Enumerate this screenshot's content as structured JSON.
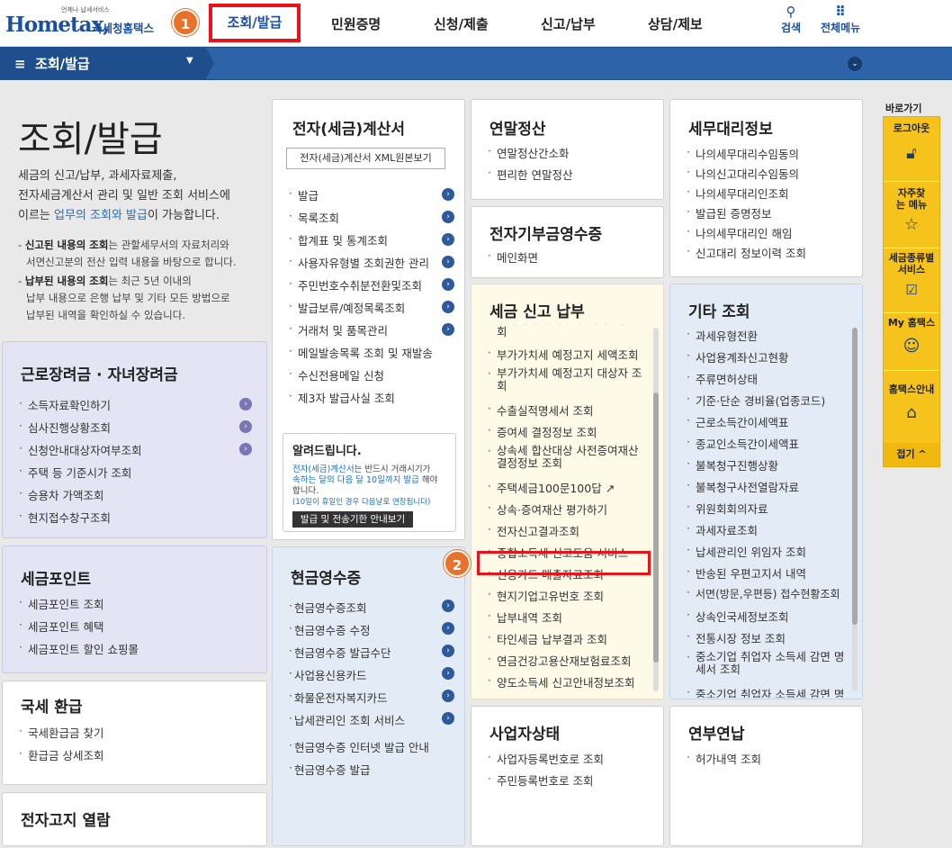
{
  "header": {
    "logo_tagline": "언제나 납세서비스",
    "logo_word": "Hometax,",
    "logo_sub": "국세청홈택스",
    "nav": [
      "조회/발급",
      "민원증명",
      "신청/제출",
      "신고/납부",
      "상담/제보"
    ],
    "search_label": "검색",
    "menu_label": "전체메뉴",
    "step1": "1",
    "step2": "2"
  },
  "breadcrumb": {
    "label": "조회/발급"
  },
  "intro": {
    "title": "조회/발급",
    "desc_1": "세금의 신고/납부, 과세자료제출,",
    "desc_2": "전자세금계산서 관리 및 일반 조회 서비스에",
    "desc_3a": "이르는 ",
    "desc_3b": "업무의 조회와 발급",
    "desc_3c": "이 가능합니다.",
    "note1_bold": "신고된 내용의 조회",
    "note1_rest": "는 관할세무서의 자료처리와",
    "note1_line2": "서면신고분의 전산 입력 내용을 바탕으로 합니다.",
    "note2_bold": "납부된 내용의 조회",
    "note2_rest": "는 최근 5년 이내의",
    "note2_line2": "납부 내용으로 은행 납부 및 기타 모든 방법으로",
    "note2_line3": "납부된 내역을 확인하실 수 있습니다."
  },
  "panels": {
    "work_reward": {
      "title": "근로장려금 · 자녀장려금",
      "items": [
        "소득자료확인하기",
        "심사진행상황조회",
        "신청안내대상자여부조회",
        "주택 등 기준시가 조회",
        "승용차 가액조회",
        "현지접수창구조회"
      ]
    },
    "tax_point": {
      "title": "세금포인트",
      "items": [
        "세금포인트 조회",
        "세금포인트 혜택",
        "세금포인트 할인 쇼핑몰"
      ]
    },
    "refund": {
      "title": "국세 환급",
      "items": [
        "국세환급금 찾기",
        "환급금 상세조회"
      ]
    },
    "e_notice": {
      "title": "전자고지 열람"
    },
    "e_invoice": {
      "title": "전자(세금)계산서",
      "button": "전자(세금)계산서 XML원본보기",
      "items": [
        "발급",
        "목록조회",
        "합계표 및 통계조회",
        "사용자유형별 조회권한 관리",
        "주민번호수취분전환및조회",
        "발급보류/예정목록조회",
        "거래처 및 품목관리",
        "메일발송목록 조회 및 재발송",
        "수신전용메일 신청",
        "제3자 발급사실 조회"
      ]
    },
    "notice_box": {
      "title": "알려드립니다.",
      "line1a": "전자(세금)계산서",
      "line1b": "는 반드시 거래시기가",
      "line2a": "속하는 달의 다음 달 10일까지 발급",
      "line2b": " 해야",
      "line3": "합니다.",
      "line4": "(10일이 휴일인 경우 다음날로 연장됩니다)",
      "button": "발급 및 전송기한 안내보기"
    },
    "cash_receipt": {
      "title": "현금영수증",
      "items": [
        "현금영수증조회",
        "현금영수증 수정",
        "현금영수증 발급수단",
        "사업용신용카드",
        "화물운전자복지카드",
        "납세관리인 조회 서비스",
        "현금영수증 인터넷 발급 안내",
        "현금영수증 발급"
      ]
    },
    "year_end": {
      "title": "연말정산",
      "items": [
        "연말정산간소화",
        "편리한 연말정산"
      ]
    },
    "donation": {
      "title": "전자기부금영수증",
      "items": [
        "메인화면"
      ]
    },
    "tax_report": {
      "title": "세금 신고 납부",
      "items": [
        "부가가치세 카드사 대리납부 조회",
        "부가가치세 예정고지 세액조회",
        "부가가치세 예정고지 대상자 조회",
        "수출실적명세서 조회",
        "증여세 결정정보 조회",
        "상속세 합산대상 사전증여재산 결정정보 조회",
        "주택세금100문100답",
        "상속·증여재산 평가하기",
        "전자신고결과조회",
        "종합소득세 신고도움 서비스",
        "신용카드 매출자료조회",
        "현지기업고유번호 조회",
        "납부내역 조회",
        "타인세금 납부결과 조회",
        "연금건강고용산재보험료조회",
        "양도소득세 신고안내정보조회"
      ]
    },
    "biz_status": {
      "title": "사업자상태",
      "items": [
        "사업자등록번호로 조회",
        "주민등록번호로 조회"
      ]
    },
    "agent_info": {
      "title": "세무대리정보",
      "items": [
        "나의세무대리수임동의",
        "나의신고대리수임동의",
        "나의세무대리인조회",
        "발급된 증명정보",
        "나의세무대리인 해임",
        "신고대리 정보이력 조회"
      ]
    },
    "other": {
      "title": "기타 조회",
      "items": [
        "과세유형전환",
        "사업용계좌신고현황",
        "주류면허상태",
        "기준·단순 경비율(업종코드)",
        "근로소득간이세액표",
        "종교인소득간이세액표",
        "불복청구진행상황",
        "불복청구사전열람자료",
        "위원회회의자료",
        "과세자료조회",
        "납세관리인 위임자 조회",
        "반송된 우편고지서 내역",
        "서면(방문,우편등) 접수현황조회",
        "상속인국세정보조회",
        "전통시장 정보 조회",
        "중소기업 취업자 소득세 감면 명세서 조회",
        "중소기업 취업자 소득세 감면 명"
      ]
    },
    "annual": {
      "title": "연부연납",
      "items": [
        "허가내역 조회"
      ]
    }
  },
  "quick_menu": {
    "title": "바로가기",
    "items": [
      {
        "label": "로그아웃",
        "icon": "unlock-icon"
      },
      {
        "label": "자주찾는 메뉴",
        "icon": "star-icon"
      },
      {
        "label": "세금종류별 서비스",
        "icon": "checkbox-icon"
      },
      {
        "label": "My 홈택스",
        "icon": "user-icon"
      },
      {
        "label": "홈택스안내",
        "icon": "home-hand-icon"
      }
    ],
    "fold": "접기 ^"
  },
  "colors": {
    "accent": "#1b4fa0",
    "highlight": "#e8141b",
    "step": "#e6722c"
  }
}
